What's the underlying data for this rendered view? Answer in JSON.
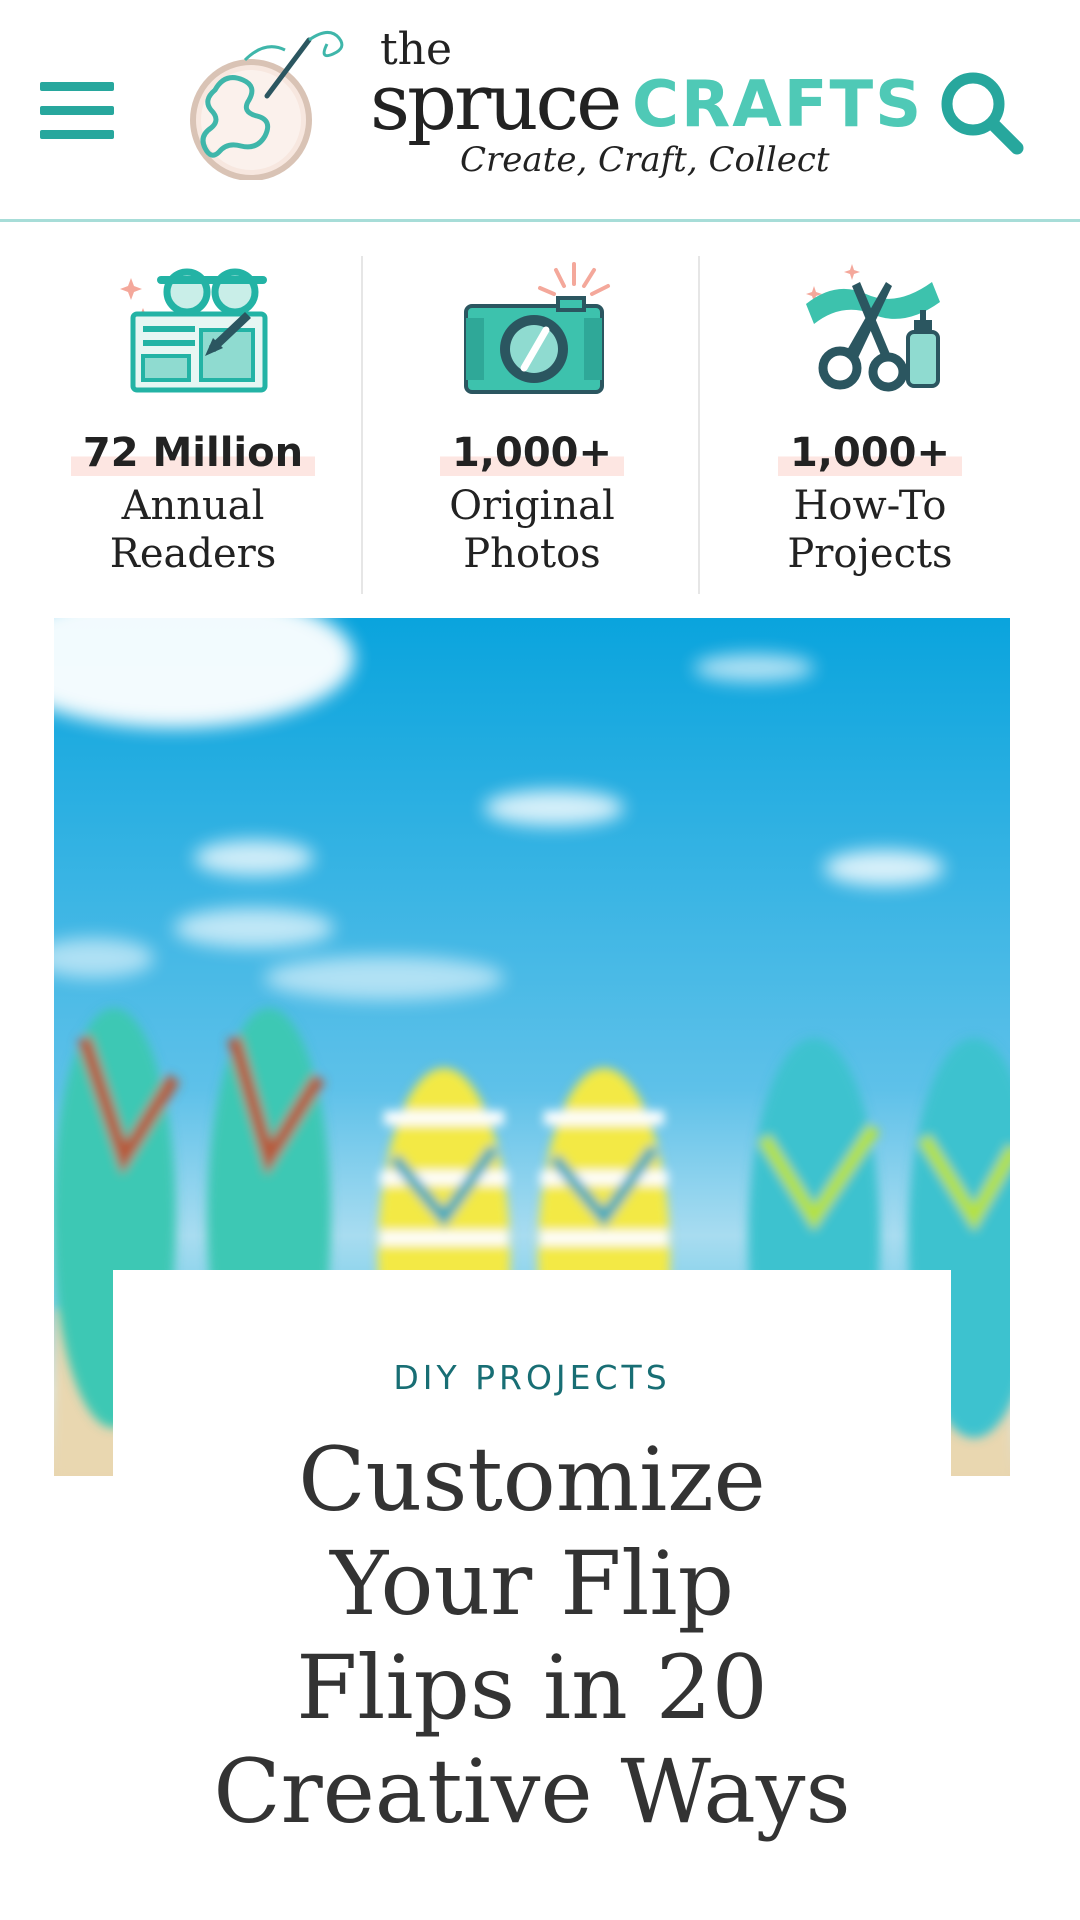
{
  "header": {
    "logo": {
      "the": "the",
      "spruce": "spruce",
      "crafts": "CRAFTS",
      "tagline": "Create, Craft, Collect"
    },
    "colors": {
      "accent": "#27a79d",
      "crafts": "#4fc9b6",
      "divider": "#a7ddd8"
    }
  },
  "stats": [
    {
      "icon": "glasses-board-icon",
      "number": "72 Million",
      "label_line1": "Annual",
      "label_line2": "Readers"
    },
    {
      "icon": "camera-icon",
      "number": "1,000+",
      "label_line1": "Original",
      "label_line2": "Photos"
    },
    {
      "icon": "scissors-glue-icon",
      "number": "1,000+",
      "label_line1": "How-To",
      "label_line2": "Projects"
    }
  ],
  "article": {
    "category": "DIY PROJECTS",
    "title_lines": [
      "Customize",
      "Your Flip",
      "Flips in 20",
      "Creative Ways"
    ],
    "hero_image": "flip-flops-on-beach"
  }
}
